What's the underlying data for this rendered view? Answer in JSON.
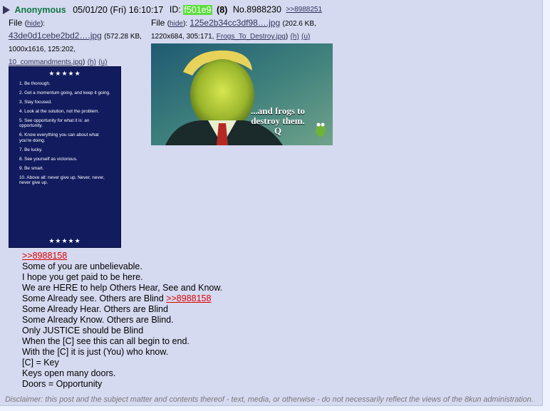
{
  "post": {
    "name": "Anonymous",
    "date": "05/01/20 (Fri) 16:10:17",
    "id_label": "ID:",
    "id_value": "f501e9",
    "count": "(8)",
    "number": "No.8988230",
    "backlink": ">>8988251"
  },
  "files": [
    {
      "label": "File",
      "hide": "hide",
      "filename": "43de0d1cebe2bd2….jpg",
      "meta": "(572.28 KB, 1000x1616, 125:202,",
      "original": "10_commandments.jpg",
      "h": "(h)",
      "u": "(u)"
    },
    {
      "label": "File",
      "hide": "hide",
      "filename": "125e2b34cc3df98….jpg",
      "meta": "(202.6 KB, 1220x684, 305:171,",
      "original": "Frogs_To_Destroy.jpg",
      "h": "(h)",
      "u": "(u)"
    }
  ],
  "thumb1": {
    "stars_top": "★★★★★",
    "stars_bottom": "★★★★★",
    "items": [
      "1. Be thorough.",
      "2. Get a momentum going, and keep it going.",
      "3. Stay focused.",
      "4. Look at the solution, not the problem.",
      "5. See opportunity for what it is: an opportunity.",
      "6. Know everything you can about what you're doing.",
      "7. Be lucky.",
      "8. See yourself as victorious.",
      "9. Be smart.",
      "10. Above all: never give up. Never, never, never give up."
    ]
  },
  "thumb2": {
    "caption_line1": "...and frogs to",
    "caption_line2": "destroy them.",
    "caption_sig": "Q"
  },
  "message": {
    "quote1": ">>8988158",
    "lines": [
      "Some of you are unbelievable.",
      "I hope you get paid to be here.",
      "We are HERE to help Others Hear, See and Know."
    ],
    "line_with_quote_text": "Some Already see. Others are Blind ",
    "quote2": ">>8988158",
    "lines2": [
      "Some Already Hear. Others are Blind",
      "Some Already Know. Others are Blind.",
      "Only JUSTICE should be Blind",
      "When the [C] see this can all begin to end.",
      "With the [C] it is just (You) who know.",
      "[C] = Key",
      "Keys open many doors.",
      "Doors = Opportunity"
    ]
  },
  "disclaimer": "Disclaimer: this post and the subject matter and contents thereof - text, media, or otherwise - do not necessarily reflect the views of the 8kun administration."
}
